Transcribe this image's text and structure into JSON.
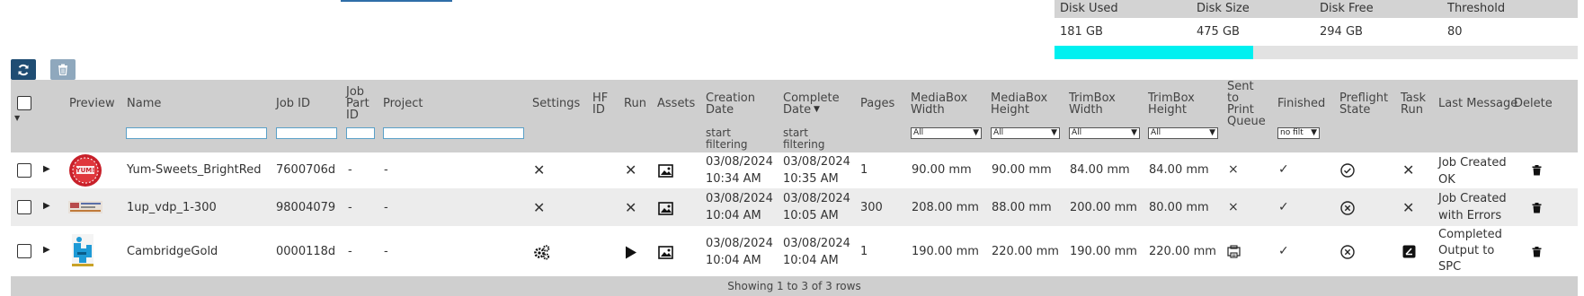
{
  "disk": {
    "headers": [
      "Disk Used",
      "Disk Size",
      "Disk Free",
      "Threshold"
    ],
    "values": [
      "181 GB",
      "475 GB",
      "294 GB",
      "80"
    ],
    "usage_fraction": 0.38,
    "bar_color": "#00f0f0"
  },
  "toolbar": {
    "refresh_icon": "refresh-icon",
    "delete_icon": "trash-icon"
  },
  "table": {
    "headers": {
      "preview": "Preview",
      "name": "Name",
      "job_id": "Job ID",
      "job_part_id": "Job\nPart\nID",
      "project": "Project",
      "settings": "Settings",
      "hf_id": "HF\nID",
      "run": "Run",
      "assets": "Assets",
      "creation_date": "Creation\nDate",
      "complete_date": "Complete\nDate",
      "pages": "Pages",
      "mediabox_width": "MediaBox\nWidth",
      "mediabox_height": "MediaBox\nHeight",
      "trimbox_width": "TrimBox\nWidth",
      "trimbox_height": "TrimBox\nHeight",
      "sent_to_print_queue": "Sent\nto\nPrint\nQueue",
      "finished": "Finished",
      "preflight_state": "Preflight\nState",
      "task_run": "Task\nRun",
      "last_message": "Last Message",
      "delete": "Delete"
    },
    "filters": {
      "creation_date_hint": "start\nfiltering",
      "complete_date_hint": "start\nfiltering",
      "mediabox_width": "All",
      "mediabox_height": "All",
      "trimbox_width": "All",
      "trimbox_height": "All",
      "finished": "no filt"
    },
    "rows": [
      {
        "name": "Yum-Sweets_BrightRed",
        "job_id": "7600706d",
        "job_part_id": "-",
        "project": "-",
        "settings": "none",
        "run": "none",
        "creation_date": "03/08/2024\n10:34 AM",
        "complete_date": "03/08/2024\n10:35 AM",
        "pages": "1",
        "mediabox_width": "90.00 mm",
        "mediabox_height": "90.00 mm",
        "trimbox_width": "84.00 mm",
        "trimbox_height": "84.00 mm",
        "sent": "×",
        "finished": "✓",
        "preflight": "ok",
        "task_run": "none",
        "last_message": "Job Created\nOK"
      },
      {
        "name": "1up_vdp_1-300",
        "job_id": "98004079",
        "job_part_id": "-",
        "project": "-",
        "settings": "none",
        "run": "none",
        "creation_date": "03/08/2024\n10:04 AM",
        "complete_date": "03/08/2024\n10:05 AM",
        "pages": "300",
        "mediabox_width": "208.00 mm",
        "mediabox_height": "88.00 mm",
        "trimbox_width": "200.00 mm",
        "trimbox_height": "80.00 mm",
        "sent": "×",
        "finished": "✓",
        "preflight": "error",
        "task_run": "none",
        "last_message": "Job Created\nwith Errors"
      },
      {
        "name": "CambridgeGold",
        "job_id": "0000118d",
        "job_part_id": "-",
        "project": "-",
        "settings": "gears",
        "run": "play",
        "creation_date": "03/08/2024\n10:04 AM",
        "complete_date": "03/08/2024\n10:04 AM",
        "pages": "1",
        "mediabox_width": "190.00 mm",
        "mediabox_height": "220.00 mm",
        "trimbox_width": "190.00 mm",
        "trimbox_height": "220.00 mm",
        "sent": "queue",
        "finished": "✓",
        "preflight": "error",
        "task_run": "task",
        "last_message": "Completed\nOutput to\nSPC"
      }
    ],
    "footer": "Showing 1 to 3 of 3 rows"
  }
}
